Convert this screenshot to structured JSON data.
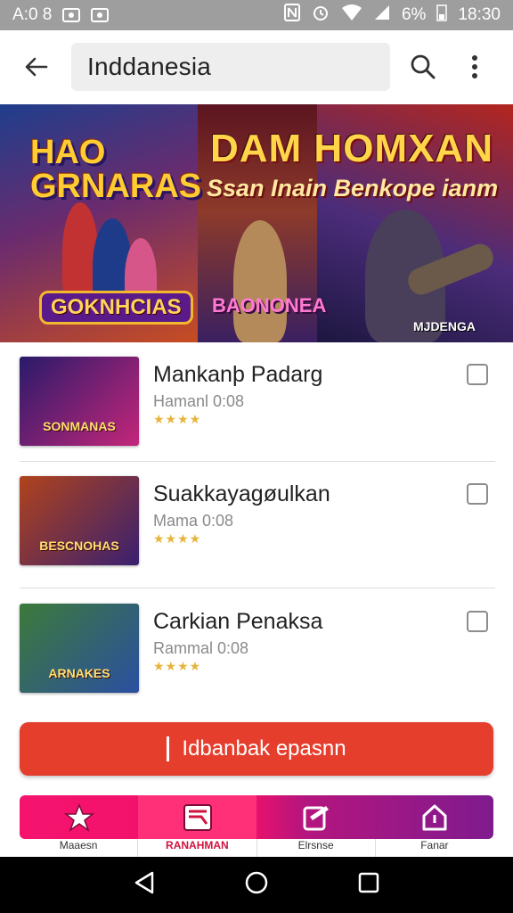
{
  "status_bar": {
    "time_left": "A:0 8",
    "battery": "6%",
    "time_right": "18:30"
  },
  "top_bar": {
    "search_value": "Inddanesia"
  },
  "banner": {
    "title": "DAM HOMXAN",
    "subtitle": "Ssan Inain Benkope ianm",
    "logo_left": "HAO GRNARAS",
    "logo_bottom_left": "GOKNHCIAS",
    "logo_center": "BAONONEA",
    "tag": "MJDENGA"
  },
  "items": [
    {
      "title": "Mankanþ Padarg",
      "subtitle": "Hamanl 0:08",
      "stars": "★★★★",
      "thumb_text": "SONMANAS",
      "colors": [
        "#2a1a6a",
        "#c4267a"
      ]
    },
    {
      "title": "Suakkayaɡøulkan",
      "subtitle": "Mama 0:08",
      "stars": "★★★★",
      "thumb_text": "BESCNOHAS",
      "colors": [
        "#b0431c",
        "#3a2070"
      ]
    },
    {
      "title": "Carkian Penaksa",
      "subtitle": "Rammal 0:08",
      "stars": "★★★★",
      "thumb_text": "ARNAKES",
      "colors": [
        "#3c7a3a",
        "#2b4fa0"
      ]
    }
  ],
  "cta": {
    "label": "Idbanbak epasnn"
  },
  "bottom_nav": [
    {
      "label": "Maaesn",
      "icon": "star-icon"
    },
    {
      "label": "RANAHMAN",
      "icon": "image-icon"
    },
    {
      "label": "Elrsnse",
      "icon": "edit-icon"
    },
    {
      "label": "Fanar",
      "icon": "home-icon"
    }
  ]
}
